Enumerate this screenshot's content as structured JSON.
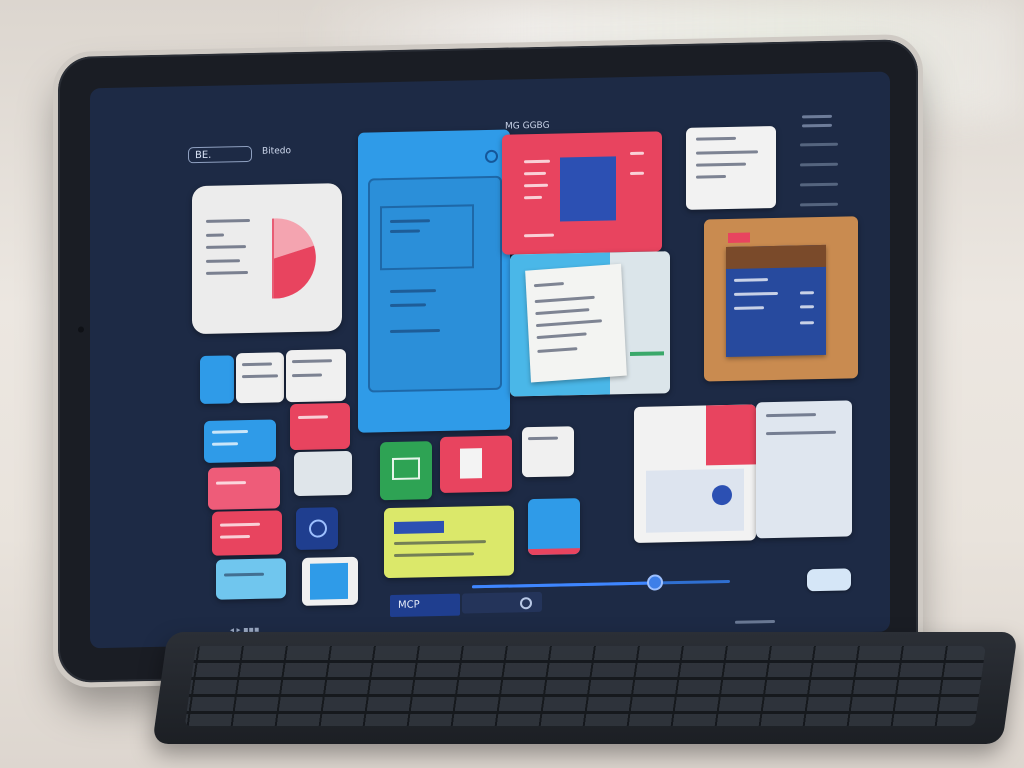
{
  "topbar": {
    "pill_label": "BE.",
    "side_label": "Bitedo",
    "center_label": "MG GGBG"
  },
  "bottom": {
    "tag_label": "MCP",
    "slider_fraction": 0.71
  },
  "colors": {
    "screen_bg": "#1d2a45",
    "accent_blue": "#2f9be8",
    "accent_red": "#e8445f",
    "accent_green": "#2ea354",
    "accent_yellow": "#dbe86a",
    "accent_orange": "#c98b50"
  },
  "icons": {
    "search": "search-icon",
    "menu": "menu-icon",
    "pie_chart": "pie-chart-icon"
  }
}
